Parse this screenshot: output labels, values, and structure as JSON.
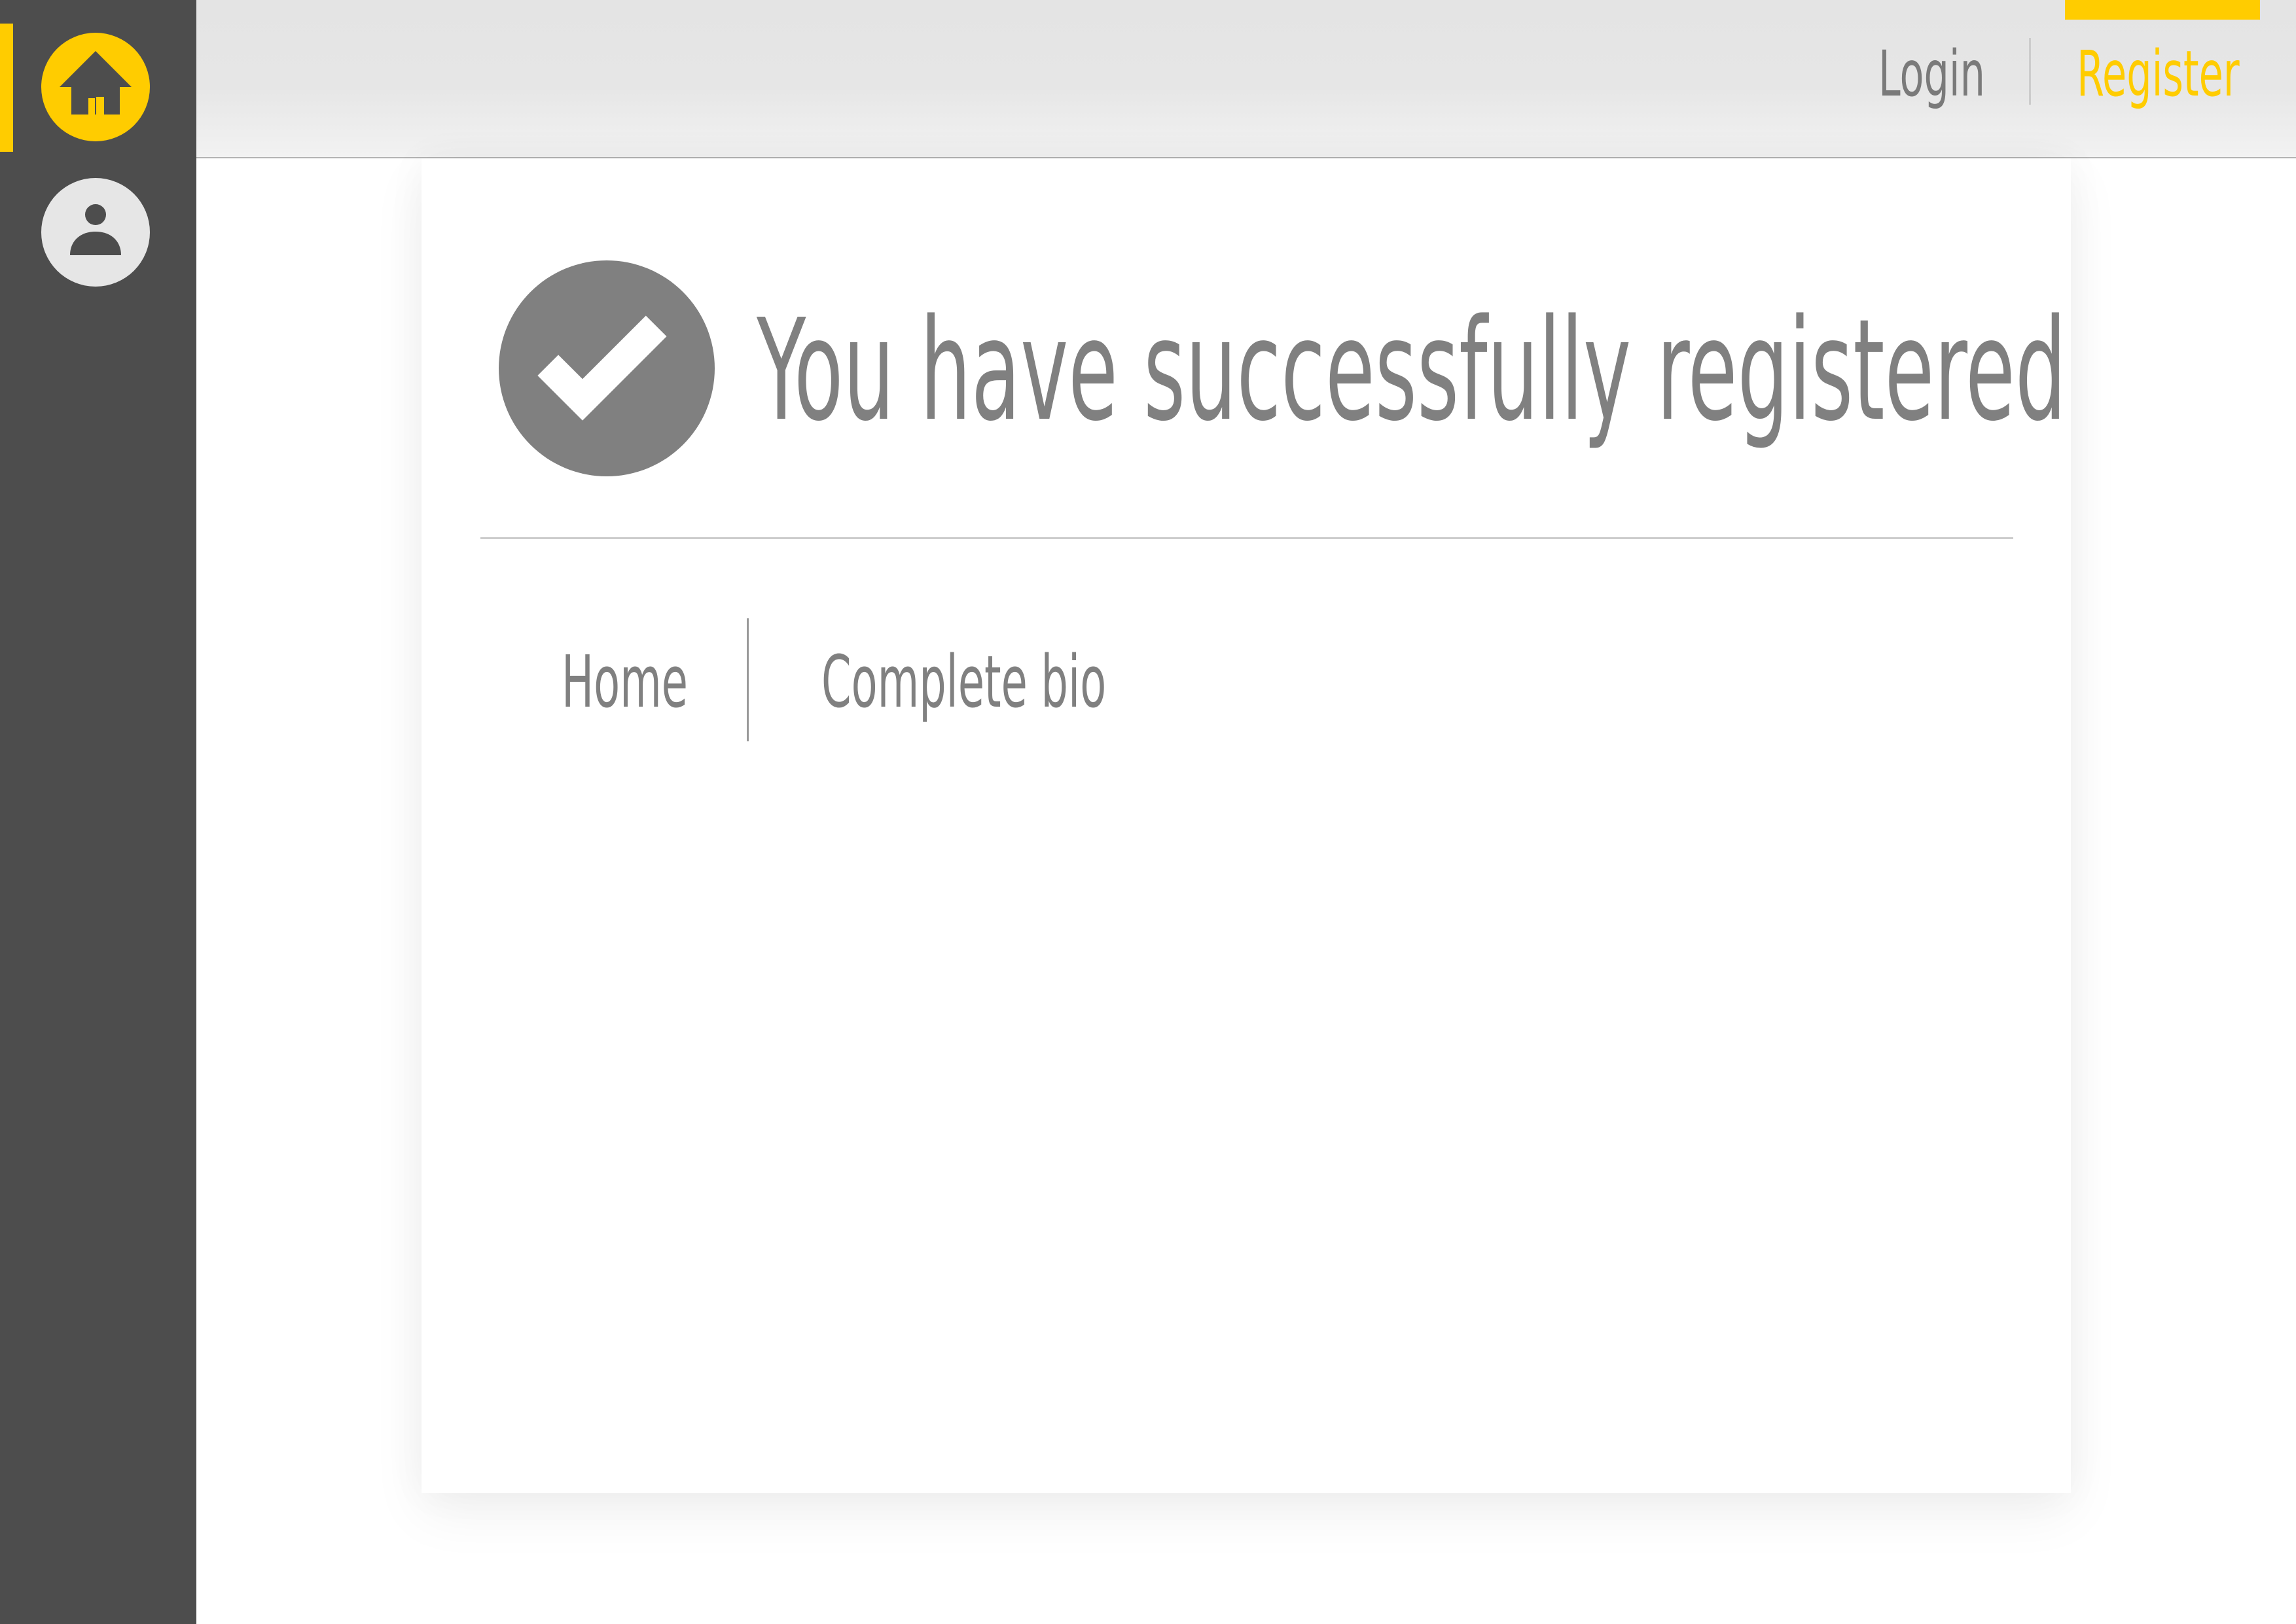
{
  "sidebar": {
    "items": [
      {
        "icon": "home-icon",
        "active": true
      },
      {
        "icon": "user-icon",
        "active": false
      }
    ]
  },
  "header": {
    "login_label": "Login",
    "register_label": "Register",
    "active_tab": "Register"
  },
  "main": {
    "status_icon": "checkmark-icon",
    "message": "You have successfully registered",
    "links": {
      "home_label": "Home",
      "complete_bio_label": "Complete bio"
    }
  },
  "colors": {
    "accent": "#ffcc00",
    "sidebar_bg": "#4d4d4d",
    "topbar_bg": "#e6e6e6",
    "text_gray": "#808080"
  }
}
